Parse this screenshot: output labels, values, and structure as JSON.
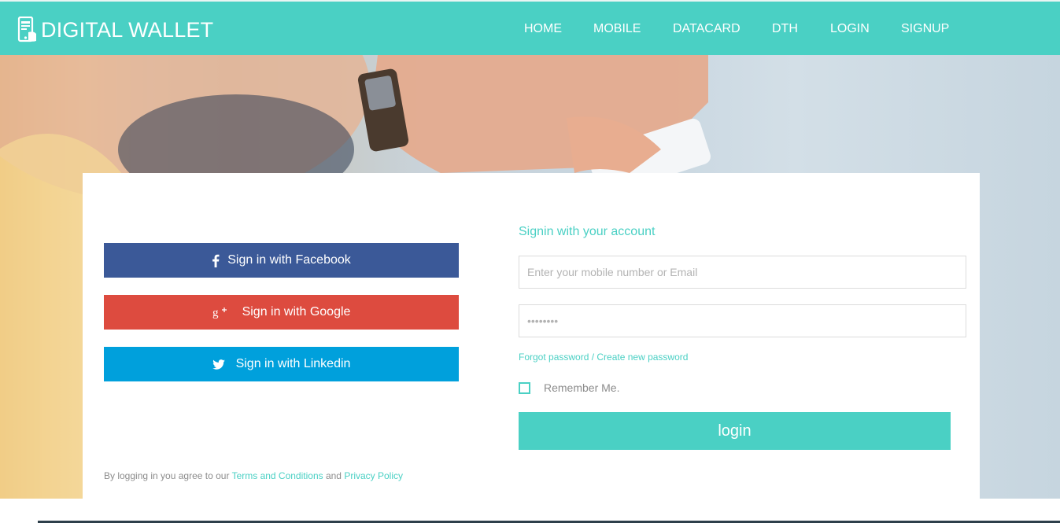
{
  "brand": {
    "title": "DIGITAL WALLET",
    "icon": "mobile-wallet-icon"
  },
  "nav": {
    "items": [
      {
        "label": "HOME"
      },
      {
        "label": "MOBILE"
      },
      {
        "label": "DATACARD"
      },
      {
        "label": "DTH"
      },
      {
        "label": "LOGIN"
      },
      {
        "label": "SIGNUP"
      }
    ]
  },
  "social": {
    "facebook": {
      "label": "Sign in with Facebook",
      "icon": "facebook-icon",
      "color": "#3b5998"
    },
    "google": {
      "label": "Sign in with Google",
      "icon": "google-plus-icon",
      "color": "#dd4b3f"
    },
    "linkedin": {
      "label": "Sign in with Linkedin",
      "icon": "twitter-icon",
      "color": "#00a0dc"
    }
  },
  "terms": {
    "prefix": "By logging in you agree to our ",
    "terms_link": "Terms and Conditions",
    "conjunction": " and ",
    "privacy_link": "Privacy Policy"
  },
  "signin": {
    "title": "Signin with your account",
    "user_placeholder": "Enter your mobile number or Email",
    "password_placeholder": "••••••••",
    "forgot": "Forgot password / Create new password",
    "remember": "Remember Me.",
    "login": "login"
  },
  "colors": {
    "accent": "#4ad0c4",
    "text_muted": "#8c8c8c"
  }
}
